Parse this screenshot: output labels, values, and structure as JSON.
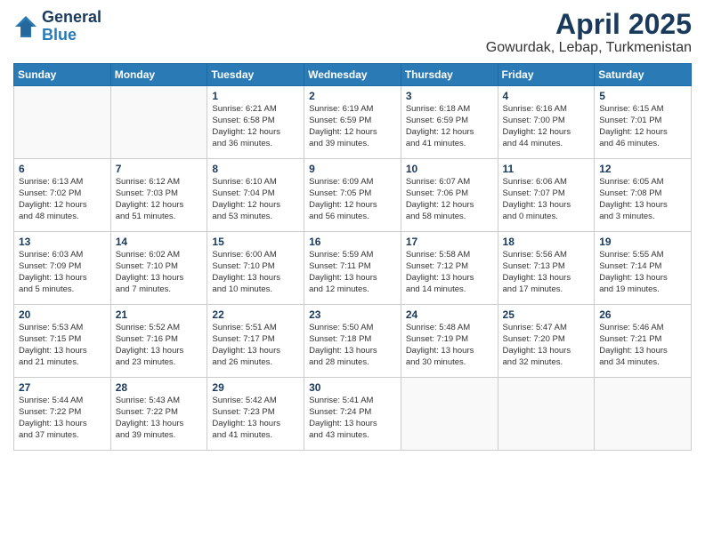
{
  "header": {
    "logo_general": "General",
    "logo_blue": "Blue",
    "month_title": "April 2025",
    "location": "Gowurdak, Lebap, Turkmenistan"
  },
  "weekdays": [
    "Sunday",
    "Monday",
    "Tuesday",
    "Wednesday",
    "Thursday",
    "Friday",
    "Saturday"
  ],
  "weeks": [
    [
      {
        "day": "",
        "info": ""
      },
      {
        "day": "",
        "info": ""
      },
      {
        "day": "1",
        "info": "Sunrise: 6:21 AM\nSunset: 6:58 PM\nDaylight: 12 hours\nand 36 minutes."
      },
      {
        "day": "2",
        "info": "Sunrise: 6:19 AM\nSunset: 6:59 PM\nDaylight: 12 hours\nand 39 minutes."
      },
      {
        "day": "3",
        "info": "Sunrise: 6:18 AM\nSunset: 6:59 PM\nDaylight: 12 hours\nand 41 minutes."
      },
      {
        "day": "4",
        "info": "Sunrise: 6:16 AM\nSunset: 7:00 PM\nDaylight: 12 hours\nand 44 minutes."
      },
      {
        "day": "5",
        "info": "Sunrise: 6:15 AM\nSunset: 7:01 PM\nDaylight: 12 hours\nand 46 minutes."
      }
    ],
    [
      {
        "day": "6",
        "info": "Sunrise: 6:13 AM\nSunset: 7:02 PM\nDaylight: 12 hours\nand 48 minutes."
      },
      {
        "day": "7",
        "info": "Sunrise: 6:12 AM\nSunset: 7:03 PM\nDaylight: 12 hours\nand 51 minutes."
      },
      {
        "day": "8",
        "info": "Sunrise: 6:10 AM\nSunset: 7:04 PM\nDaylight: 12 hours\nand 53 minutes."
      },
      {
        "day": "9",
        "info": "Sunrise: 6:09 AM\nSunset: 7:05 PM\nDaylight: 12 hours\nand 56 minutes."
      },
      {
        "day": "10",
        "info": "Sunrise: 6:07 AM\nSunset: 7:06 PM\nDaylight: 12 hours\nand 58 minutes."
      },
      {
        "day": "11",
        "info": "Sunrise: 6:06 AM\nSunset: 7:07 PM\nDaylight: 13 hours\nand 0 minutes."
      },
      {
        "day": "12",
        "info": "Sunrise: 6:05 AM\nSunset: 7:08 PM\nDaylight: 13 hours\nand 3 minutes."
      }
    ],
    [
      {
        "day": "13",
        "info": "Sunrise: 6:03 AM\nSunset: 7:09 PM\nDaylight: 13 hours\nand 5 minutes."
      },
      {
        "day": "14",
        "info": "Sunrise: 6:02 AM\nSunset: 7:10 PM\nDaylight: 13 hours\nand 7 minutes."
      },
      {
        "day": "15",
        "info": "Sunrise: 6:00 AM\nSunset: 7:10 PM\nDaylight: 13 hours\nand 10 minutes."
      },
      {
        "day": "16",
        "info": "Sunrise: 5:59 AM\nSunset: 7:11 PM\nDaylight: 13 hours\nand 12 minutes."
      },
      {
        "day": "17",
        "info": "Sunrise: 5:58 AM\nSunset: 7:12 PM\nDaylight: 13 hours\nand 14 minutes."
      },
      {
        "day": "18",
        "info": "Sunrise: 5:56 AM\nSunset: 7:13 PM\nDaylight: 13 hours\nand 17 minutes."
      },
      {
        "day": "19",
        "info": "Sunrise: 5:55 AM\nSunset: 7:14 PM\nDaylight: 13 hours\nand 19 minutes."
      }
    ],
    [
      {
        "day": "20",
        "info": "Sunrise: 5:53 AM\nSunset: 7:15 PM\nDaylight: 13 hours\nand 21 minutes."
      },
      {
        "day": "21",
        "info": "Sunrise: 5:52 AM\nSunset: 7:16 PM\nDaylight: 13 hours\nand 23 minutes."
      },
      {
        "day": "22",
        "info": "Sunrise: 5:51 AM\nSunset: 7:17 PM\nDaylight: 13 hours\nand 26 minutes."
      },
      {
        "day": "23",
        "info": "Sunrise: 5:50 AM\nSunset: 7:18 PM\nDaylight: 13 hours\nand 28 minutes."
      },
      {
        "day": "24",
        "info": "Sunrise: 5:48 AM\nSunset: 7:19 PM\nDaylight: 13 hours\nand 30 minutes."
      },
      {
        "day": "25",
        "info": "Sunrise: 5:47 AM\nSunset: 7:20 PM\nDaylight: 13 hours\nand 32 minutes."
      },
      {
        "day": "26",
        "info": "Sunrise: 5:46 AM\nSunset: 7:21 PM\nDaylight: 13 hours\nand 34 minutes."
      }
    ],
    [
      {
        "day": "27",
        "info": "Sunrise: 5:44 AM\nSunset: 7:22 PM\nDaylight: 13 hours\nand 37 minutes."
      },
      {
        "day": "28",
        "info": "Sunrise: 5:43 AM\nSunset: 7:22 PM\nDaylight: 13 hours\nand 39 minutes."
      },
      {
        "day": "29",
        "info": "Sunrise: 5:42 AM\nSunset: 7:23 PM\nDaylight: 13 hours\nand 41 minutes."
      },
      {
        "day": "30",
        "info": "Sunrise: 5:41 AM\nSunset: 7:24 PM\nDaylight: 13 hours\nand 43 minutes."
      },
      {
        "day": "",
        "info": ""
      },
      {
        "day": "",
        "info": ""
      },
      {
        "day": "",
        "info": ""
      }
    ]
  ]
}
